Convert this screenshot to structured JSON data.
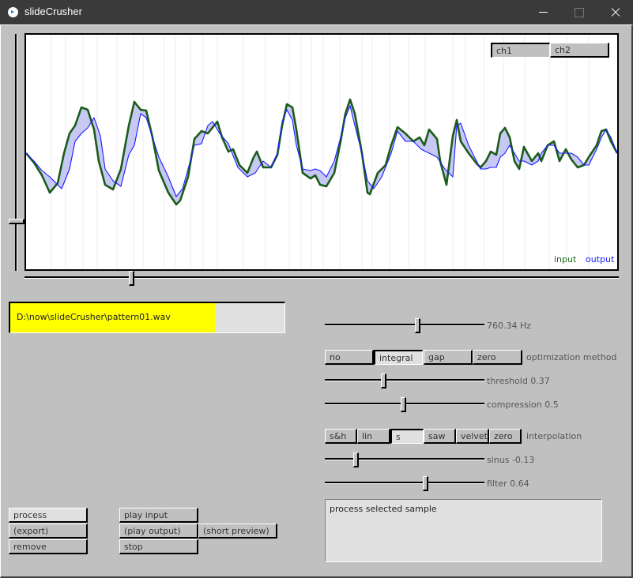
{
  "window": {
    "title": "slideCrusher",
    "controls": [
      "minimize",
      "maximize",
      "close"
    ]
  },
  "waveform": {
    "channel_buttons": [
      {
        "label": "ch1",
        "selected": false
      },
      {
        "label": "ch2",
        "selected": true
      }
    ],
    "legend": {
      "input": "input",
      "output": "output"
    },
    "colors": {
      "input": "#1a5c1a",
      "output": "#1a1aff",
      "fill": "#c8c8f5"
    },
    "vertical_zoom_fraction": 0.78,
    "scroll_position_fraction": 0.18
  },
  "file": {
    "path": "D:\\now\\slideCrusher\\pattern01.wav",
    "progress_fraction": 0.75,
    "progress_color": "#ffff00"
  },
  "controls": {
    "frequency": {
      "label": "760.34 Hz",
      "fraction": 0.58
    },
    "optimization": {
      "label": "optimization method",
      "options": [
        "no",
        "integral",
        "gap",
        "zero"
      ],
      "selected": "integral"
    },
    "threshold": {
      "label": "threshold 0.37",
      "value": 0.37
    },
    "compression": {
      "label": "compression 0.5",
      "value": 0.5
    },
    "interpolation": {
      "label": "interpolation",
      "options": [
        "s&h",
        "lin",
        "s",
        "saw",
        "velvet",
        "zero"
      ],
      "selected": "s"
    },
    "sinus": {
      "label": "sinus -0.13",
      "fraction": 0.2
    },
    "filter": {
      "label": "filter 0.64",
      "fraction": 0.64
    }
  },
  "actions": {
    "process": "process",
    "export": "(export)",
    "remove": "remove",
    "play_input": "play input",
    "play_output": "(play output)",
    "short_preview": "(short preview)",
    "stop": "stop"
  },
  "status": {
    "message": "process selected sample"
  }
}
